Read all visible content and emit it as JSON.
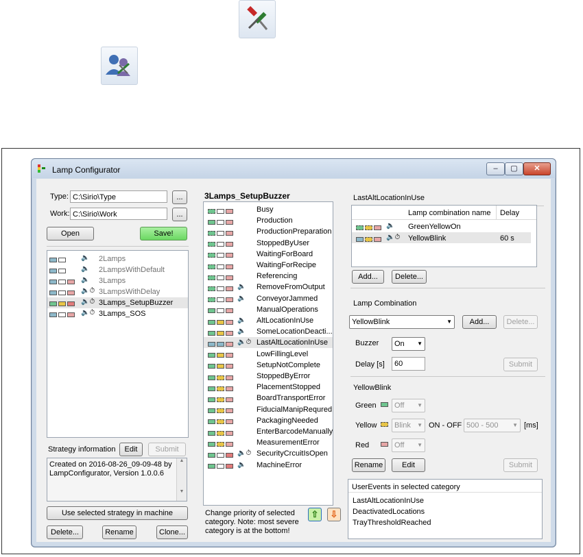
{
  "window": {
    "title": "Lamp Configurator",
    "controls": {
      "minimize": "‒",
      "maximize": "▢",
      "close": "✕"
    }
  },
  "paths": {
    "type_label": "Type:",
    "type_value": "C:\\Sirio\\Type",
    "work_label": "Work:",
    "work_value": "C:\\Sirio\\Work",
    "browse_label": "..."
  },
  "buttons": {
    "open": "Open",
    "save": "Save!",
    "edit": "Edit",
    "submit": "Submit",
    "use_strategy": "Use selected strategy in machine",
    "delete": "Delete...",
    "rename": "Rename",
    "clone": "Clone...",
    "add": "Add...",
    "lc_add": "Add...",
    "lc_delete": "Delete...",
    "lc_submit": "Submit",
    "yb_rename": "Rename",
    "yb_edit": "Edit",
    "yb_submit": "Submit"
  },
  "strategies": [
    {
      "name": "2Lamps",
      "selected": false
    },
    {
      "name": "2LampsWithDefault",
      "selected": false
    },
    {
      "name": "3Lamps",
      "selected": false
    },
    {
      "name": "3LampsWithDelay",
      "selected": false
    },
    {
      "name": "3Lamps_SetupBuzzer",
      "selected": true
    },
    {
      "name": "3Lamps_SOS",
      "selected": false
    }
  ],
  "strategy_info": {
    "label": "Strategy information",
    "text_line1": "Created on 2016-08-26_09-09-48 by",
    "text_line2": "LampConfigurator, Version 1.0.0.6"
  },
  "categories_title": "3Lamps_SetupBuzzer",
  "categories": [
    "Busy",
    "Production",
    "ProductionPreparation",
    "StoppedByUser",
    "WaitingForBoard",
    "WaitingForRecipe",
    "Referencing",
    "RemoveFromOutput",
    "ConveyorJammed",
    "ManualOperations",
    "AltLocationInUse",
    "SomeLocationDeacti...",
    "LastAltLocationInUse",
    "LowFillingLevel",
    "SetupNotComplete",
    "StoppedByError",
    "PlacementStopped",
    "BoardTransportError",
    "FiducialManipRequred",
    "PackagingNeeded",
    "EnterBarcodeManually",
    "MeasurementError",
    "SecurityCrcuitIsOpen",
    "MachineError"
  ],
  "selected_category": "LastAltLocationInUse",
  "priority_note": {
    "line1": "Change priority of selected",
    "line2": "category. Note: most severe",
    "line3": "category is at the bottom!"
  },
  "last_alt": {
    "title": "LastAltLocationInUse",
    "col_name": "Lamp combination name",
    "col_delay": "Delay",
    "rows": [
      {
        "name": "GreenYellowOn",
        "delay": ""
      },
      {
        "name": "YellowBlink",
        "delay": "60 s"
      }
    ]
  },
  "lamp_combination": {
    "title": "Lamp Combination",
    "selected": "YellowBlink",
    "buzzer_label": "Buzzer",
    "buzzer_value": "On",
    "delay_label": "Delay [s]",
    "delay_value": "60"
  },
  "yellow_blink": {
    "title": "YellowBlink",
    "green_label": "Green",
    "green_value": "Off",
    "yellow_label": "Yellow",
    "yellow_value": "Blink",
    "onoff_label": "ON - OFF",
    "onoff_value": "500 - 500",
    "ms_label": "[ms]",
    "red_label": "Red",
    "red_value": "Off"
  },
  "user_events": {
    "title": "UserEvents in selected category",
    "items": [
      "LastAltLocationInUse",
      "DeactivatedLocations",
      "TrayThresholdReached"
    ]
  },
  "colors": {
    "accent_green": "#6bd862",
    "selection": "#e6e6e6",
    "window_frame": "#cfdbe9"
  },
  "icons": {
    "settings_tools": "screwdriver-tools-icon",
    "user_settings": "user-settings-icon"
  }
}
